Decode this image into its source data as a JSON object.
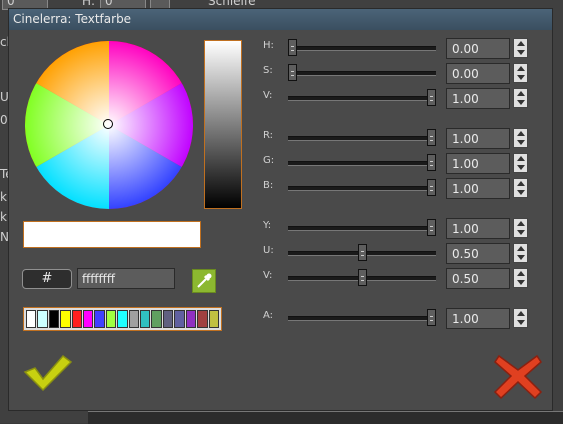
{
  "window": {
    "title": "Cinelerra: Textfarbe"
  },
  "background": {
    "field_a": "0",
    "field_b_label": "H:",
    "field_b": "0",
    "top_right_text": "Schleife",
    "left_fragments": [
      "ch",
      "Ur",
      "0",
      "Te",
      "kF",
      "kF",
      "No"
    ]
  },
  "hex": {
    "hash_label": "#",
    "value": "ffffffff"
  },
  "sliders": [
    {
      "label": "H:",
      "value": "0.00",
      "fraction": 0.0
    },
    {
      "label": "S:",
      "value": "0.00",
      "fraction": 0.0
    },
    {
      "label": "V:",
      "value": "1.00",
      "fraction": 1.0
    },
    {
      "label": "R:",
      "value": "1.00",
      "fraction": 1.0
    },
    {
      "label": "G:",
      "value": "1.00",
      "fraction": 1.0
    },
    {
      "label": "B:",
      "value": "1.00",
      "fraction": 1.0
    },
    {
      "label": "Y:",
      "value": "1.00",
      "fraction": 1.0
    },
    {
      "label": "U:",
      "value": "0.50",
      "fraction": 0.5
    },
    {
      "label": "V:",
      "value": "0.50",
      "fraction": 0.5
    },
    {
      "label": "A:",
      "value": "1.00",
      "fraction": 1.0
    }
  ],
  "palette": [
    "#ffffff",
    "#ccffff",
    "#000000",
    "#ffff00",
    "#ff2020",
    "#ff00ff",
    "#4040ff",
    "#a0ff40",
    "#20ffff",
    "#a0a0a0",
    "#30c0c0",
    "#60a060",
    "#606080",
    "#6060a0",
    "#9030c0",
    "#a04040",
    "#c0c040"
  ],
  "colors": {
    "accent_border": "#c07020",
    "ok": "#c8d010",
    "cancel": "#e04020"
  },
  "icons": {
    "ok": "checkmark-icon",
    "cancel": "cross-icon",
    "picker": "eyedropper-icon"
  }
}
